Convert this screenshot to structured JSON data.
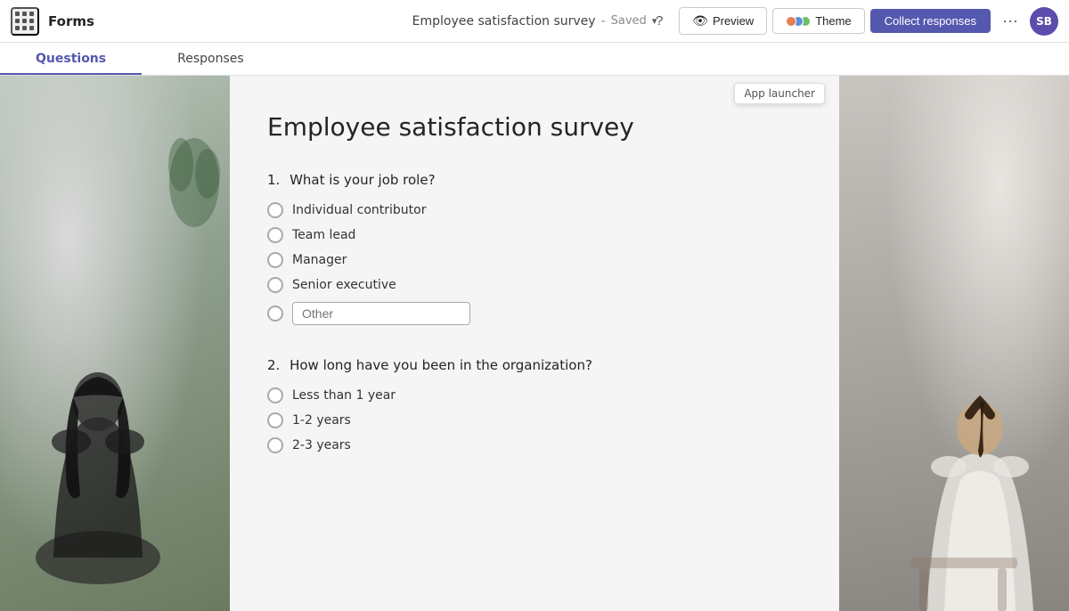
{
  "app": {
    "launcher_label": "App launcher",
    "forms_label": "Forms"
  },
  "topbar": {
    "survey_title": "Employee satisfaction survey",
    "separator": "-",
    "saved_label": "Saved",
    "help_icon": "?",
    "preview_label": "Preview",
    "theme_label": "Theme",
    "collect_label": "Collect responses",
    "more_icon": "···",
    "avatar_initials": "SB"
  },
  "tabs": [
    {
      "id": "questions",
      "label": "Questions",
      "active": true
    },
    {
      "id": "responses",
      "label": "Responses",
      "active": false
    }
  ],
  "form": {
    "title": "Employee satisfaction survey",
    "app_launcher_tooltip": "App launcher",
    "questions": [
      {
        "number": "1.",
        "text": "What is your job role?",
        "type": "radio",
        "options": [
          {
            "label": "Individual contributor"
          },
          {
            "label": "Team lead"
          },
          {
            "label": "Manager"
          },
          {
            "label": "Senior executive"
          },
          {
            "label": "Other",
            "is_other": true
          }
        ]
      },
      {
        "number": "2.",
        "text": "How long have you been in the organization?",
        "type": "radio",
        "options": [
          {
            "label": "Less than 1 year"
          },
          {
            "label": "1-2 years"
          },
          {
            "label": "2-3 years"
          }
        ]
      }
    ]
  }
}
